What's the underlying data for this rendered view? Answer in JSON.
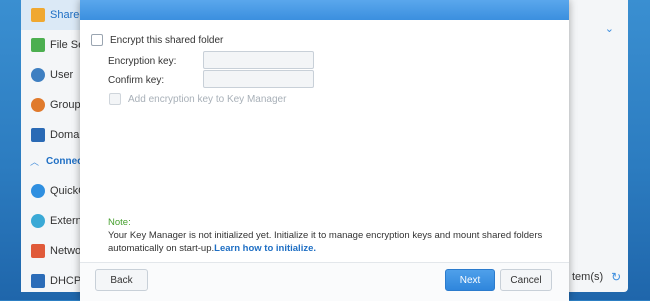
{
  "sidebar": {
    "items": [
      {
        "label": "Shared",
        "icon": "shared-folder-icon",
        "color": "#f0a830",
        "active": true
      },
      {
        "label": "File Se",
        "icon": "file-services-icon",
        "color": "#4caf50"
      },
      {
        "label": "User",
        "icon": "user-icon",
        "color": "#3e7fc1"
      },
      {
        "label": "Group",
        "icon": "group-icon",
        "color": "#e07a2c"
      },
      {
        "label": "Domai",
        "icon": "domain-icon",
        "color": "#2a6ab5"
      }
    ],
    "section_label": "Connect",
    "items2": [
      {
        "label": "QuickC",
        "icon": "quickconnect-icon",
        "color": "#2f8fe0"
      },
      {
        "label": "Extern",
        "icon": "external-access-icon",
        "color": "#3aa9d6"
      },
      {
        "label": "Netwo",
        "icon": "network-icon",
        "color": "#e05a3a"
      },
      {
        "label": "DHCP S",
        "icon": "dhcp-server-icon",
        "color": "#2b6cb8"
      }
    ]
  },
  "background_footer": {
    "text": "tem(s)"
  },
  "dialog": {
    "encrypt_label": "Encrypt this shared folder",
    "encryption_key_label": "Encryption key:",
    "confirm_key_label": "Confirm key:",
    "key_manager_label": "Add encryption key to Key Manager",
    "note_title": "Note:",
    "note_text": "Your Key Manager is not initialized yet. Initialize it to manage encryption keys and mount shared folders automatically on start-up.",
    "note_link": "Learn how to initialize.",
    "back_label": "Back",
    "next_label": "Next",
    "cancel_label": "Cancel"
  },
  "colors": {
    "accent": "#3b8fdf",
    "note_title": "#47a02f",
    "link": "#1f6fc4"
  }
}
